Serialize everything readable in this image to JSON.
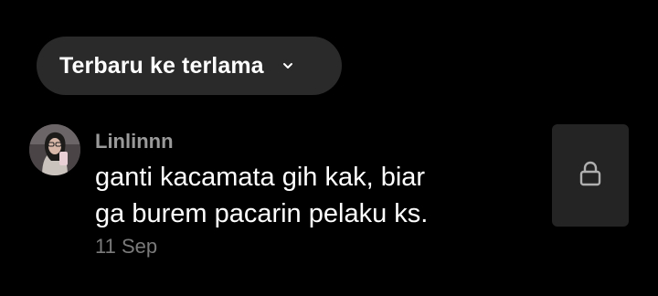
{
  "sort": {
    "label": "Terbaru ke terlama",
    "icon": "chevron-down-icon"
  },
  "comment": {
    "username": "Linlinnn",
    "lines": [
      "ganti kacamata gih kak, biar",
      "ga burem pacarin pelaku ks."
    ],
    "date": "11 Sep",
    "thumbnail_icon": "lock-icon"
  },
  "colors": {
    "background": "#000000",
    "pill": "#2a2a2a",
    "username": "#9a9a9a",
    "date": "#7a7a7a",
    "tile": "#242424"
  }
}
